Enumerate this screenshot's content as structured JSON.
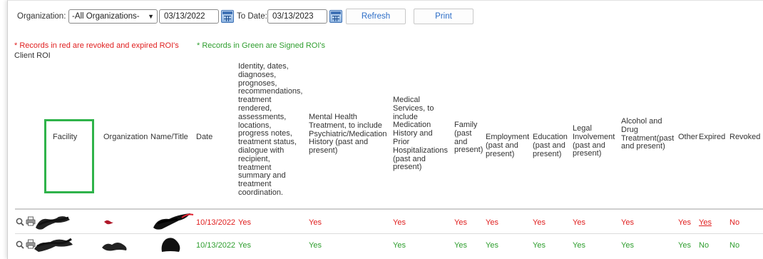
{
  "filters": {
    "org_label": "Organization:",
    "org_value": "-All Organizations-",
    "from_date": "03/13/2022",
    "to_label": "To Date:",
    "to_date": "03/13/2023",
    "refresh_label": "Refresh",
    "print_label": "Print"
  },
  "notes": {
    "red_note": "* Records in red are revoked and expired ROI's",
    "green_note": "* Records in Green are Signed ROI's",
    "section_title": "Client ROI"
  },
  "columns": {
    "facility": "Facility",
    "organization": "Organization",
    "name_title": "Name/Title",
    "date": "Date",
    "identity": [
      "Identity, dates,",
      "diagnoses,",
      "prognoses,",
      "recommendations,",
      "treatment",
      "rendered,",
      "assessments,",
      "locations,",
      "progress notes,",
      "treatment status,",
      "dialogue with",
      "recipient,",
      "treatment",
      "summary and",
      "treatment",
      "coordination."
    ],
    "mental_health": [
      "Mental Health",
      "Treatment, to include",
      "Psychiatric/Medication",
      "History (past and",
      "present)"
    ],
    "medical": [
      "Medical",
      "Services, to",
      "include",
      "Medication",
      "History and",
      "Prior",
      "Hospitalizations",
      "(past and",
      "present)"
    ],
    "family": [
      "Family",
      "(past",
      "and",
      "present)"
    ],
    "employment": [
      "Employment",
      "(past and",
      "present)"
    ],
    "education": [
      "Education",
      "(past and",
      "present)"
    ],
    "legal": [
      "Legal",
      "Involvement",
      "(past and",
      "present)"
    ],
    "alcohol": [
      "Alcohol and",
      "Drug",
      "Treatment(past",
      "and present)"
    ],
    "other": "Other",
    "expired": "Expired",
    "revoked": "Revoked"
  },
  "rows": [
    {
      "date": "10/13/2022",
      "identity": "Yes",
      "mental_health": "Yes",
      "medical": "Yes",
      "family": "Yes",
      "employment": "Yes",
      "education": "Yes",
      "legal": "Yes",
      "alcohol": "Yes",
      "other": "Yes",
      "expired": "Yes",
      "revoked": "No",
      "status_color": "#e02020"
    },
    {
      "date": "10/13/2022",
      "identity": "Yes",
      "mental_health": "Yes",
      "medical": "Yes",
      "family": "Yes",
      "employment": "Yes",
      "education": "Yes",
      "legal": "Yes",
      "alcohol": "Yes",
      "other": "Yes",
      "expired": "No",
      "revoked": "No",
      "status_color": "#2e9e2e"
    }
  ],
  "icons": {
    "view": "magnifier-icon",
    "print": "printer-icon",
    "calendar": "calendar-icon"
  },
  "colors": {
    "highlight_box": "#2fb34a",
    "link_blue": "#2a6cc7",
    "revoked_red": "#e02020",
    "signed_green": "#2e9e2e"
  }
}
